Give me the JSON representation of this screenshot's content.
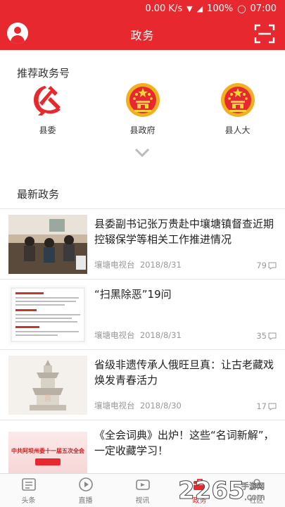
{
  "status_bar": {
    "speed": "0.00 K/s",
    "battery": "100%",
    "time": "07:00"
  },
  "header": {
    "title": "政务"
  },
  "recommend": {
    "title": "推荐政务号",
    "orgs": [
      {
        "label": "县委",
        "icon": "party-emblem-icon"
      },
      {
        "label": "县政府",
        "icon": "national-emblem-icon"
      },
      {
        "label": "县人大",
        "icon": "national-emblem-icon"
      }
    ]
  },
  "latest": {
    "title": "最新政务"
  },
  "news": [
    {
      "title": "县委副书记张万贵赴中壤塘镇督查近期控辍保学等相关工作推进情况",
      "source": "壤塘电视台",
      "date": "2018/8/31",
      "comments": "79"
    },
    {
      "title": "“扫黑除恶”19问",
      "source": "壤塘电视台",
      "date": "2018/8/31",
      "comments": "35"
    },
    {
      "title": "省级非遗传承人俄旺旦真：让古老藏戏焕发青春活力",
      "source": "壤塘电视台",
      "date": "2018/8/30",
      "comments": "17"
    },
    {
      "title": "《全会词典》出炉！这些“名词新解”，一定收藏学习！",
      "thumb_text": "中共阿坝州委十一届五次全会"
    }
  ],
  "tabs": [
    {
      "label": "头条"
    },
    {
      "label": "直播"
    },
    {
      "label": "视讯"
    },
    {
      "label": "政务"
    },
    {
      "label": "社区"
    }
  ],
  "watermark": {
    "text": "2265",
    "suffix": ".com",
    "sub": "手游网"
  },
  "colors": {
    "brand": "#e7282e"
  }
}
